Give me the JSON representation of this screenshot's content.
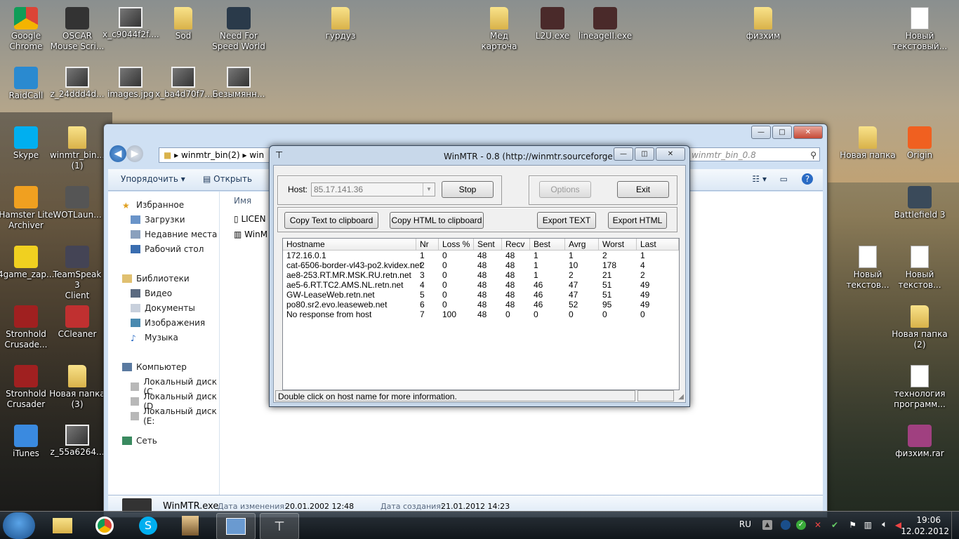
{
  "desktop": {
    "icons": [
      {
        "label": "Google\nChrome",
        "icon": "chrome-icon"
      },
      {
        "label": "OSCAR\nMouse Scri...",
        "icon": "oscar-icon"
      },
      {
        "label": "x_c9044f2f....",
        "icon": "image-icon"
      },
      {
        "label": "Sod",
        "icon": "folder-icon"
      },
      {
        "label": "Need For\nSpeed World",
        "icon": "nfs-icon"
      },
      {
        "label": "гурдуз",
        "icon": "folder-icon"
      },
      {
        "label": "Мед карточа",
        "icon": "folder-icon"
      },
      {
        "label": "L2U.exe",
        "icon": "exe-icon"
      },
      {
        "label": "lineageII.exe",
        "icon": "exe-icon"
      },
      {
        "label": "физхим",
        "icon": "folder-icon"
      },
      {
        "label": "Новый\nтекстовый...",
        "icon": "text-file-icon"
      },
      {
        "label": "RaidCall",
        "icon": "raidcall-icon"
      },
      {
        "label": "z_24ddd4d...",
        "icon": "image-icon"
      },
      {
        "label": "images.jpg",
        "icon": "image-icon"
      },
      {
        "label": "x_ba4d70f7....",
        "icon": "image-icon"
      },
      {
        "label": "Безымянн...",
        "icon": "image-icon"
      },
      {
        "label": "Skype",
        "icon": "skype-icon"
      },
      {
        "label": "winmtr_bin...\n(1)",
        "icon": "folder-icon"
      },
      {
        "label": "Новая папка",
        "icon": "folder-icon"
      },
      {
        "label": "Origin",
        "icon": "origin-icon"
      },
      {
        "label": "Hamster Lite\nArchiver",
        "icon": "hamster-icon"
      },
      {
        "label": "WOTLaun...",
        "icon": "wot-icon"
      },
      {
        "label": "Battlefield 3",
        "icon": "bf3-icon"
      },
      {
        "label": "4game_zap...",
        "icon": "4game-icon"
      },
      {
        "label": "TeamSpeak 3\nClient",
        "icon": "teamspeak-icon"
      },
      {
        "label": "Новый\nтекстов...",
        "icon": "text-file-icon"
      },
      {
        "label": "Новый\nтекстов...",
        "icon": "text-file-icon"
      },
      {
        "label": "Stronhold\nCrusade...",
        "icon": "stronghold-icon"
      },
      {
        "label": "CCleaner",
        "icon": "ccleaner-icon"
      },
      {
        "label": "Новая папка\n(2)",
        "icon": "folder-icon"
      },
      {
        "label": "Stronhold\nCrusader",
        "icon": "stronghold-icon"
      },
      {
        "label": "Новая папка\n(3)",
        "icon": "folder-icon"
      },
      {
        "label": "технология\nпрограмм...",
        "icon": "word-doc-icon"
      },
      {
        "label": "iTunes",
        "icon": "itunes-icon"
      },
      {
        "label": "z_55a6264...",
        "icon": "image-icon"
      },
      {
        "label": "физхим.rar",
        "icon": "rar-icon"
      }
    ]
  },
  "explorer": {
    "breadcrumb_1": "winmtr_bin(2)",
    "breadcrumb_2": "win",
    "search_placeholder": "winmtr_bin_0.8",
    "toolbar_organize": "Упорядочить",
    "toolbar_open": "Открыть",
    "column_name": "Имя",
    "files": [
      "LICEN",
      "WinM"
    ],
    "nav": {
      "favorites": "Избранное",
      "downloads": "Загрузки",
      "recent": "Недавние места",
      "desktop": "Рабочий стол",
      "libraries": "Библиотеки",
      "video": "Видео",
      "documents": "Документы",
      "images": "Изображения",
      "music": "Музыка",
      "computer": "Компьютер",
      "disk_c": "Локальный диск (C",
      "disk_d": "Локальный диск (D",
      "disk_e": "Локальный диск (E:",
      "network": "Сеть"
    },
    "status": {
      "filename": "WinMTR.exe",
      "modified_label": "Дата изменения:",
      "modified_value": "20.01.2002 12:48",
      "created_label": "Дата создания:",
      "created_value": "21.01.2012 14:23"
    }
  },
  "winmtr": {
    "title": "WinMTR - 0.8 (http://winmtr.sourceforge.net)",
    "host_label": "Host:",
    "host_value": "85.17.141.36",
    "buttons": {
      "stop": "Stop",
      "options": "Options",
      "exit": "Exit",
      "copy_text": "Copy Text to clipboard",
      "copy_html": "Copy HTML to clipboard",
      "export_text": "Export TEXT",
      "export_html": "Export HTML"
    },
    "columns": [
      "Hostname",
      "Nr",
      "Loss %",
      "Sent",
      "Recv",
      "Best",
      "Avrg",
      "Worst",
      "Last"
    ],
    "rows": [
      [
        "172.16.0.1",
        "1",
        "0",
        "48",
        "48",
        "1",
        "1",
        "2",
        "1"
      ],
      [
        "cat-6506-border-vl43-po2.kvidex.net",
        "2",
        "0",
        "48",
        "48",
        "1",
        "10",
        "178",
        "4"
      ],
      [
        "ae8-253.RT.MR.MSK.RU.retn.net",
        "3",
        "0",
        "48",
        "48",
        "1",
        "2",
        "21",
        "2"
      ],
      [
        "ae5-6.RT.TC2.AMS.NL.retn.net",
        "4",
        "0",
        "48",
        "48",
        "46",
        "47",
        "51",
        "49"
      ],
      [
        "GW-LeaseWeb.retn.net",
        "5",
        "0",
        "48",
        "48",
        "46",
        "47",
        "51",
        "49"
      ],
      [
        "po80.sr2.evo.leaseweb.net",
        "6",
        "0",
        "48",
        "48",
        "46",
        "52",
        "95",
        "49"
      ],
      [
        "No response from host",
        "7",
        "100",
        "48",
        "0",
        "0",
        "0",
        "0",
        "0"
      ]
    ],
    "status": "Double click on host name for more information."
  },
  "taskbar": {
    "lang": "RU",
    "time": "19:06",
    "date": "12.02.2012"
  }
}
